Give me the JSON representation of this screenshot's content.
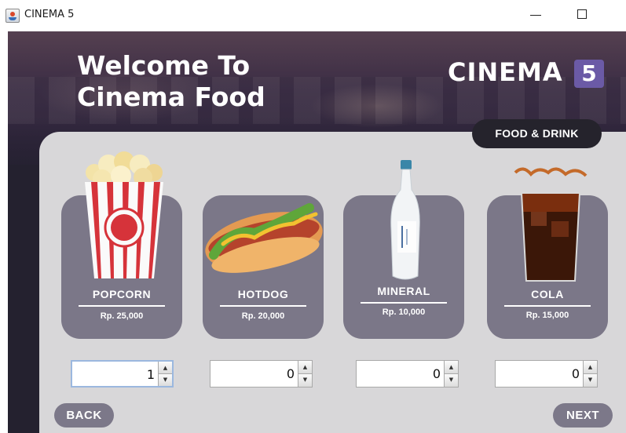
{
  "window": {
    "title": "CINEMA 5"
  },
  "header": {
    "welcome_line1": "Welcome To",
    "welcome_line2": "Cinema Food",
    "logo_text": "CINEMA",
    "logo_number": "5"
  },
  "category_tab": {
    "label": "FOOD & DRINK"
  },
  "products": [
    {
      "name": "POPCORN",
      "price": "Rp. 25,000",
      "quantity": "1",
      "icon": "popcorn-icon"
    },
    {
      "name": "HOTDOG",
      "price": "Rp. 20,000",
      "quantity": "0",
      "icon": "hotdog-icon"
    },
    {
      "name": "MINERAL",
      "price": "Rp. 10,000",
      "quantity": "0",
      "icon": "water-bottle-icon"
    },
    {
      "name": "COLA",
      "price": "Rp. 15,000",
      "quantity": "0",
      "icon": "cola-glass-icon"
    }
  ],
  "navigation": {
    "back_label": "BACK",
    "next_label": "NEXT"
  },
  "colors": {
    "app_background": "#24212f",
    "panel": "#d8d7d9",
    "card": "#7b7788",
    "logo_accent": "#6b5aa6",
    "pill": "#25232c"
  }
}
